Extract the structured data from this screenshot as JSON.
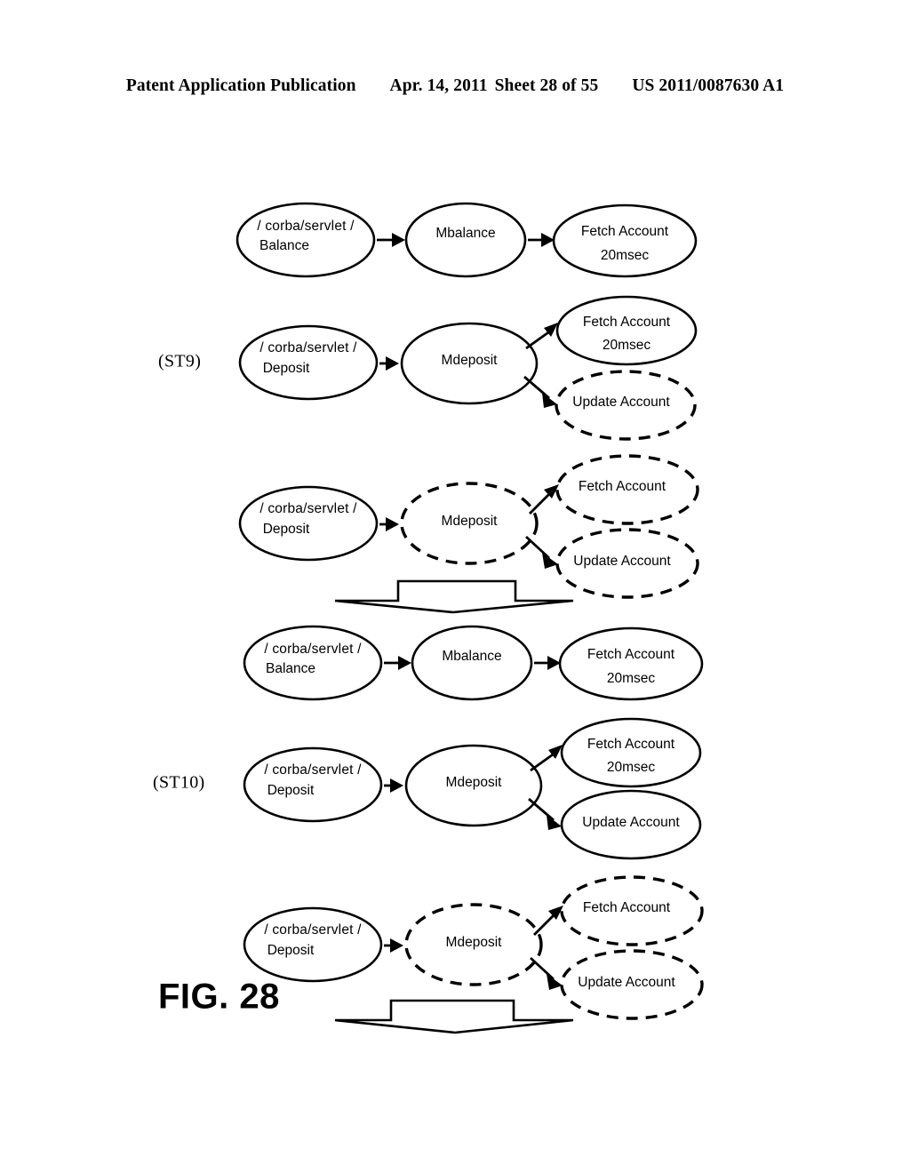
{
  "header": {
    "publication": "Patent Application Publication",
    "date": "Apr. 14, 2011",
    "sheet": "Sheet 28 of 55",
    "number": "US 2011/0087630 A1"
  },
  "figure": {
    "label": "FIG. 28",
    "groups": [
      {
        "step_label": "(ST9)",
        "rows": [
          {
            "id": "st9-row-balance",
            "nodes": [
              {
                "id": "src",
                "style": "solid",
                "lines": [
                  "/ corba/servlet /",
                  "Balance"
                ]
              },
              {
                "id": "mid",
                "style": "solid",
                "lines": [
                  "Mbalance"
                ]
              },
              {
                "id": "tgt",
                "style": "solid",
                "lines": [
                  "Fetch Account",
                  "20msec"
                ]
              }
            ]
          },
          {
            "id": "st9-row-deposit",
            "nodes": [
              {
                "id": "src",
                "style": "solid",
                "lines": [
                  "/ corba/servlet /",
                  "Deposit"
                ]
              },
              {
                "id": "mid",
                "style": "solid",
                "lines": [
                  "Mdeposit"
                ]
              },
              {
                "id": "tgt-upper",
                "style": "solid",
                "lines": [
                  "Fetch Account",
                  "20msec"
                ]
              },
              {
                "id": "tgt-lower",
                "style": "dashed",
                "lines": [
                  "Update Account"
                ]
              }
            ]
          },
          {
            "id": "st9-row-deposit-dashed",
            "nodes": [
              {
                "id": "src",
                "style": "solid",
                "lines": [
                  "/ corba/servlet /",
                  "Deposit"
                ]
              },
              {
                "id": "mid",
                "style": "dashed",
                "lines": [
                  "Mdeposit"
                ]
              },
              {
                "id": "tgt-upper",
                "style": "dashed",
                "lines": [
                  "Fetch Account"
                ]
              },
              {
                "id": "tgt-lower",
                "style": "dashed",
                "lines": [
                  "Update Account"
                ]
              }
            ]
          }
        ]
      },
      {
        "step_label": "(ST10)",
        "rows": [
          {
            "id": "st10-row-balance",
            "nodes": [
              {
                "id": "src",
                "style": "solid",
                "lines": [
                  "/ corba/servlet /",
                  "Balance"
                ]
              },
              {
                "id": "mid",
                "style": "solid",
                "lines": [
                  "Mbalance"
                ]
              },
              {
                "id": "tgt",
                "style": "solid",
                "lines": [
                  "Fetch Account",
                  "20msec"
                ]
              }
            ]
          },
          {
            "id": "st10-row-deposit",
            "nodes": [
              {
                "id": "src",
                "style": "solid",
                "lines": [
                  "/ corba/servlet /",
                  "Deposit"
                ]
              },
              {
                "id": "mid",
                "style": "solid",
                "lines": [
                  "Mdeposit"
                ]
              },
              {
                "id": "tgt-upper",
                "style": "solid",
                "lines": [
                  "Fetch Account",
                  "20msec"
                ]
              },
              {
                "id": "tgt-lower",
                "style": "solid",
                "lines": [
                  "Update Account"
                ]
              }
            ]
          },
          {
            "id": "st10-row-deposit-dashed",
            "nodes": [
              {
                "id": "src",
                "style": "solid",
                "lines": [
                  "/ corba/servlet /",
                  "Deposit"
                ]
              },
              {
                "id": "mid",
                "style": "dashed",
                "lines": [
                  "Mdeposit"
                ]
              },
              {
                "id": "tgt-upper",
                "style": "dashed",
                "lines": [
                  "Fetch Account"
                ]
              },
              {
                "id": "tgt-lower",
                "style": "dashed",
                "lines": [
                  "Update Account"
                ]
              }
            ]
          }
        ]
      }
    ]
  },
  "text": {
    "t_corba_servlet": "/ corba/servlet /",
    "t_balance": "Balance",
    "t_deposit": "Deposit",
    "t_mbalance": "Mbalance",
    "t_mdeposit": "Mdeposit",
    "t_fetch_account": "Fetch Account",
    "t_20msec": "20msec",
    "t_update_account": "Update Account",
    "t_st9": "(ST9)",
    "t_st10": "(ST10)",
    "t_fig": "FIG. 28"
  },
  "colors": {
    "ink": "#000000",
    "paper": "#ffffff"
  }
}
